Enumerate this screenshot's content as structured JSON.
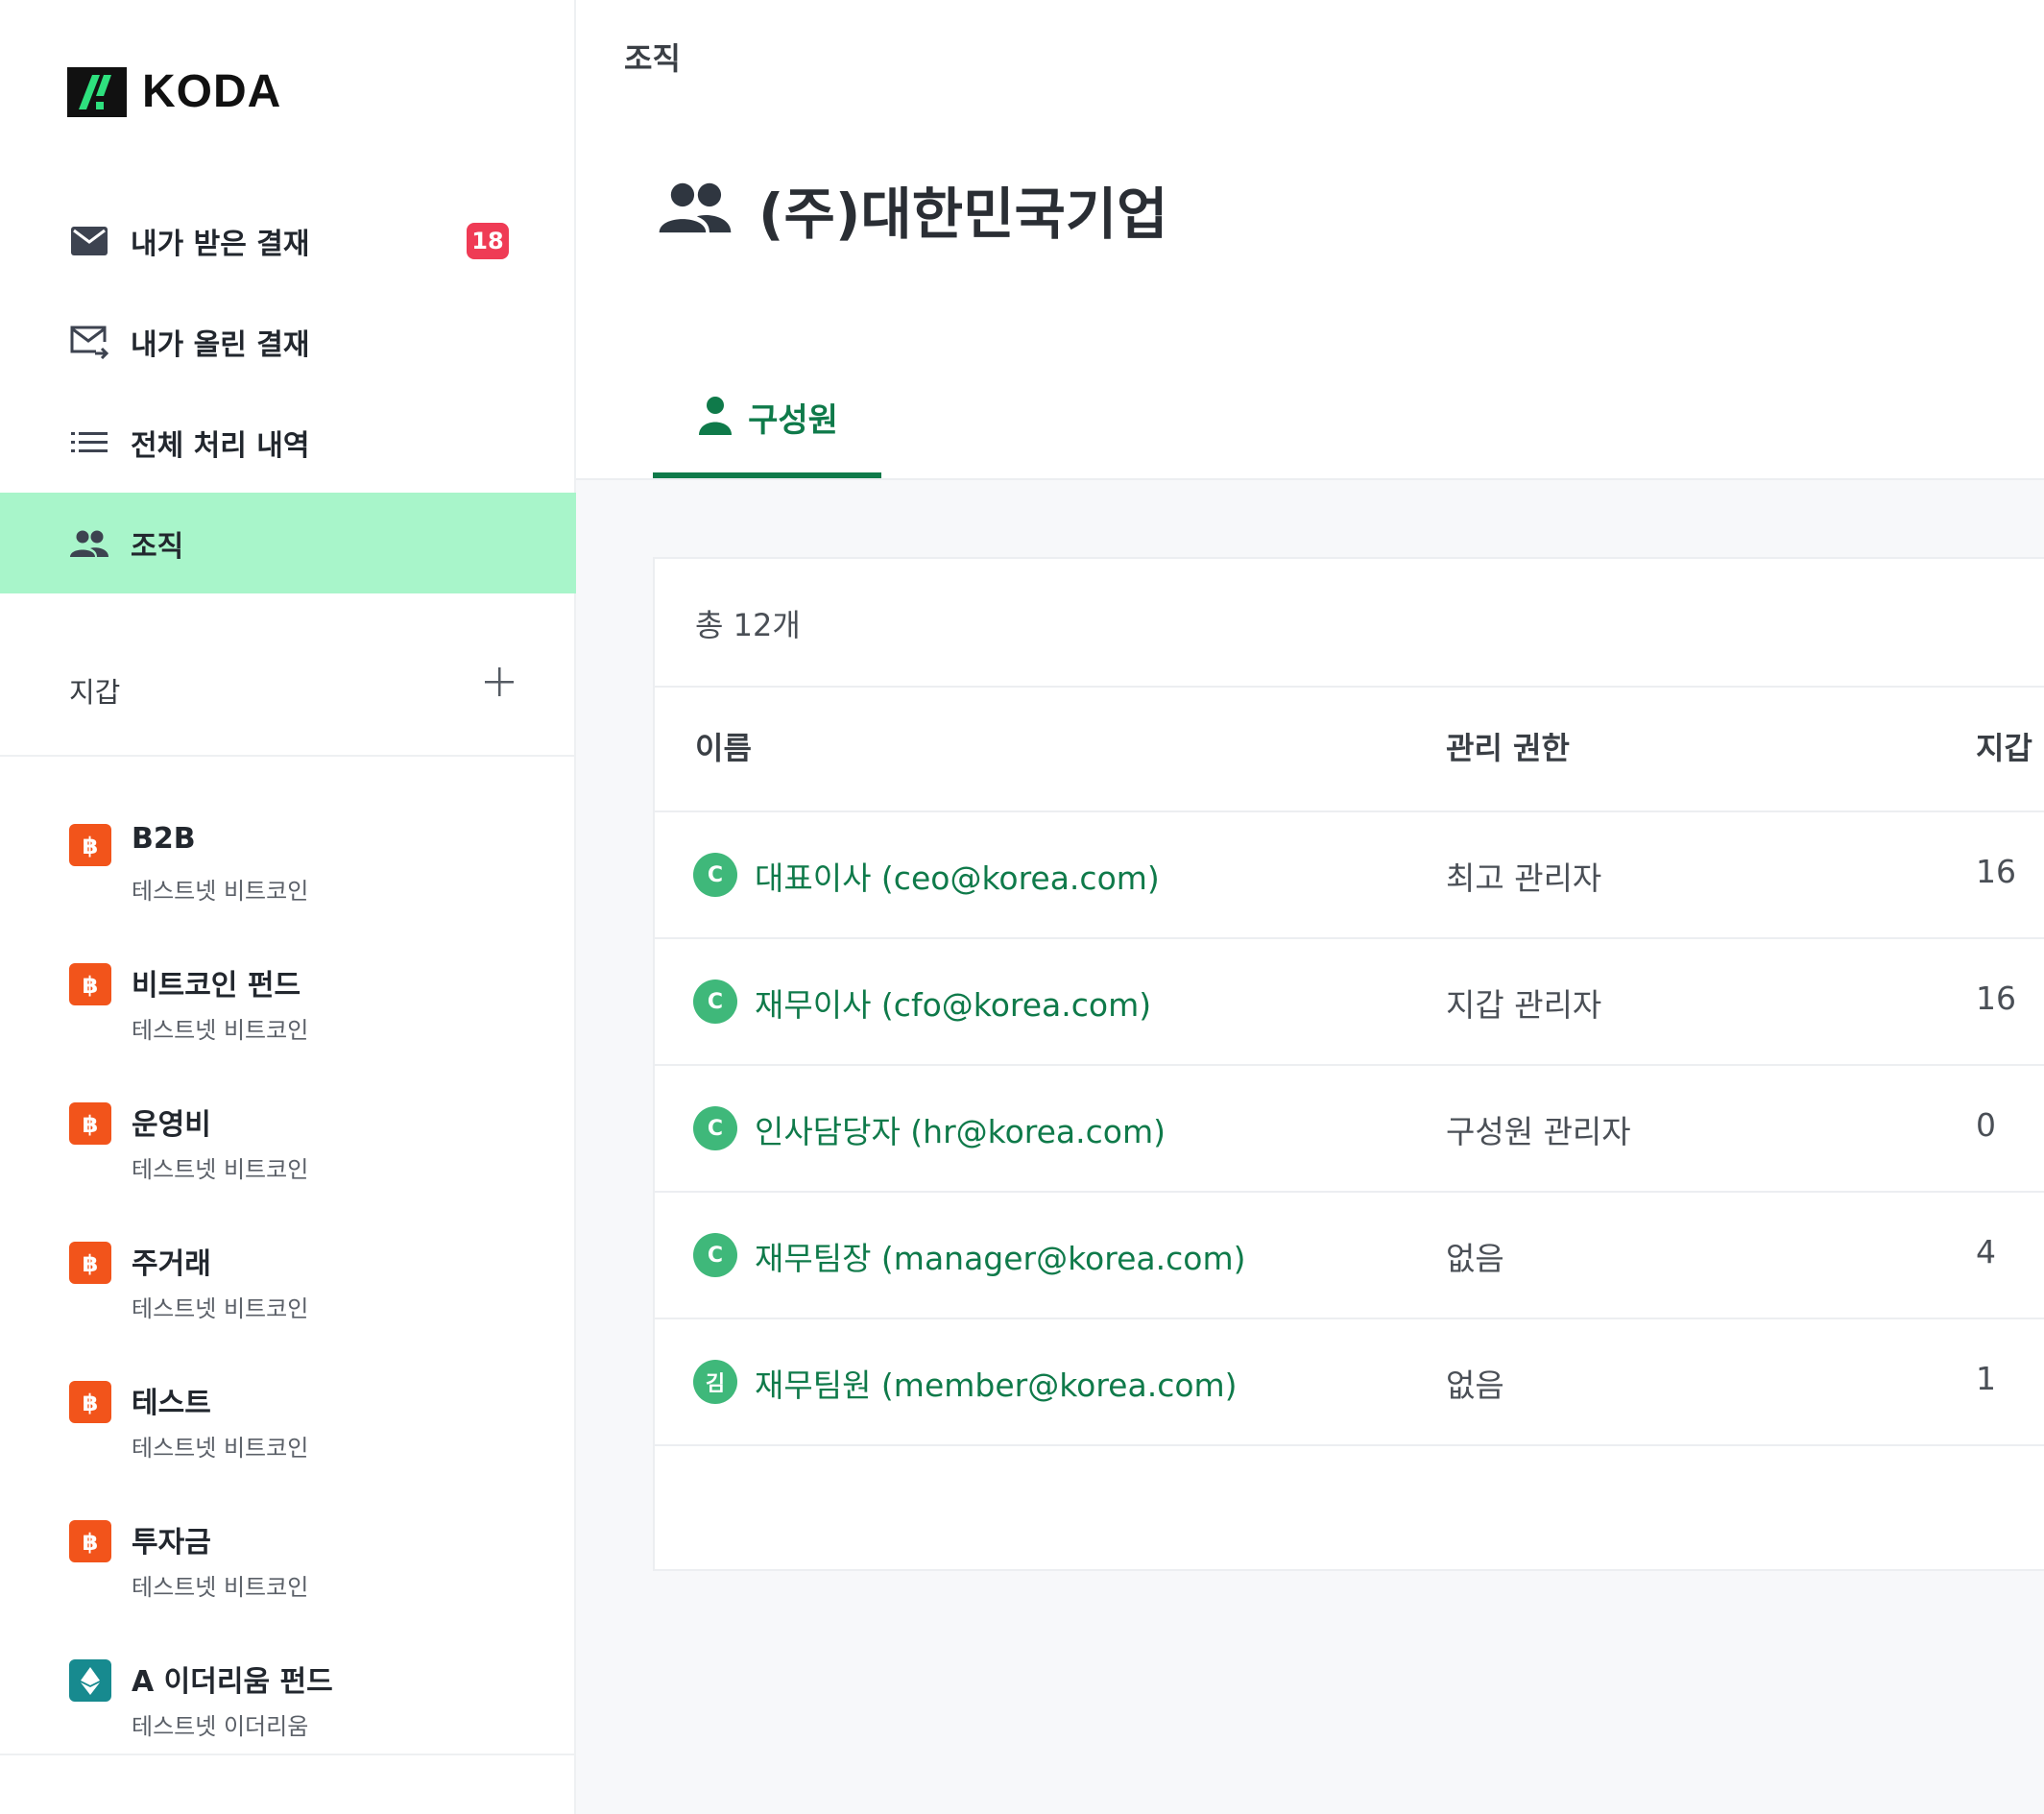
{
  "app": {
    "logo_text": "KODA",
    "brand_color": "#0f7a4a",
    "accent_color": "#a8f5ca"
  },
  "sidebar": {
    "nav": [
      {
        "label": "내가 받은 결재",
        "icon": "inbox-mail-icon",
        "badge": "18"
      },
      {
        "label": "내가 올린 결재",
        "icon": "outbox-mail-icon"
      },
      {
        "label": "전체 처리 내역",
        "icon": "list-icon"
      },
      {
        "label": "조직",
        "icon": "people-icon",
        "active": true
      }
    ],
    "wallet_section": {
      "title": "지갑",
      "add_icon": "plus-icon"
    },
    "wallets": [
      {
        "name": "B2B",
        "network": "테스트넷 비트코인",
        "coin": "bitcoin-icon"
      },
      {
        "name": "비트코인 펀드",
        "network": "테스트넷 비트코인",
        "coin": "bitcoin-icon"
      },
      {
        "name": "운영비",
        "network": "테스트넷 비트코인",
        "coin": "bitcoin-icon"
      },
      {
        "name": "주거래",
        "network": "테스트넷 비트코인",
        "coin": "bitcoin-icon"
      },
      {
        "name": "테스트",
        "network": "테스트넷 비트코인",
        "coin": "bitcoin-icon"
      },
      {
        "name": "투자금",
        "network": "테스트넷 비트코인",
        "coin": "bitcoin-icon"
      },
      {
        "name": "A 이더리움 펀드",
        "network": "테스트넷 이더리움",
        "coin": "ethereum-icon"
      }
    ]
  },
  "main": {
    "breadcrumb": "조직",
    "org_title": "(주)대한민국기업",
    "tabs": [
      {
        "label": "구성원",
        "active": true
      }
    ],
    "total": "총 12개",
    "table": {
      "headers": [
        "이름",
        "관리 권한",
        "지갑"
      ],
      "rows": [
        {
          "avatar": "C",
          "name": "대표이사 (ceo@korea.com)",
          "role": "최고 관리자",
          "wallets": "16"
        },
        {
          "avatar": "C",
          "name": "재무이사 (cfo@korea.com)",
          "role": "지갑 관리자",
          "wallets": "16"
        },
        {
          "avatar": "C",
          "name": "인사담당자 (hr@korea.com)",
          "role": "구성원 관리자",
          "wallets": "0"
        },
        {
          "avatar": "C",
          "name": "재무팀장 (manager@korea.com)",
          "role": "없음",
          "wallets": "4"
        },
        {
          "avatar": "김",
          "name": "재무팀원 (member@korea.com)",
          "role": "없음",
          "wallets": "1"
        }
      ]
    }
  }
}
